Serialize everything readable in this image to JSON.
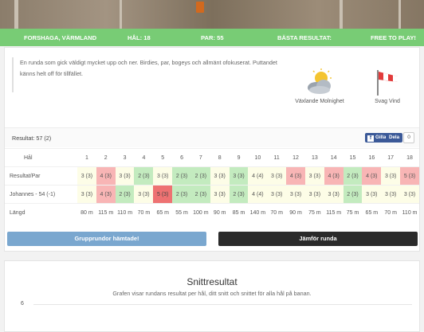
{
  "infobar": {
    "location": "FORSHAGA, VÄRMLAND",
    "hole": "HÅL: 18",
    "par": "PAR: 55",
    "best": "BÄSTA RESULTAT:",
    "fee": "FREE TO PLAY!"
  },
  "description": "En runda som gick väldigt mycket upp och ner. Birdies, par, bogeys och allmänt ofokuserat. Puttandet känns helt off för tillfället.",
  "weather": {
    "sky_label": "Växlande Molnighet",
    "sky_icon": "partly-cloudy-icon",
    "wind_label": "Svag Vind",
    "wind_icon": "windsock-icon"
  },
  "result": {
    "label": "Resultat: 57 (2)",
    "like_label": "Gilla",
    "share_label": "Dela",
    "share_count": "0"
  },
  "scorecard": {
    "hole_label": "Hål",
    "holes": [
      "1",
      "2",
      "3",
      "4",
      "5",
      "6",
      "7",
      "8",
      "9",
      "10",
      "11",
      "12",
      "13",
      "14",
      "15",
      "16",
      "17",
      "18"
    ],
    "rows": [
      {
        "label": "Resultat/Par",
        "cells": [
          {
            "text": "3 (3)",
            "status": "par"
          },
          {
            "text": "4 (3)",
            "status": "bogey"
          },
          {
            "text": "3 (3)",
            "status": "par"
          },
          {
            "text": "2 (3)",
            "status": "birdie"
          },
          {
            "text": "3 (3)",
            "status": "par"
          },
          {
            "text": "2 (3)",
            "status": "birdie"
          },
          {
            "text": "2 (3)",
            "status": "birdie"
          },
          {
            "text": "3 (3)",
            "status": "par"
          },
          {
            "text": "3 (3)",
            "status": "birdie"
          },
          {
            "text": "4 (4)",
            "status": "par"
          },
          {
            "text": "3 (3)",
            "status": "par"
          },
          {
            "text": "4 (3)",
            "status": "bogey"
          },
          {
            "text": "3 (3)",
            "status": "par"
          },
          {
            "text": "4 (3)",
            "status": "bogey"
          },
          {
            "text": "2 (3)",
            "status": "birdie"
          },
          {
            "text": "4 (3)",
            "status": "bogey"
          },
          {
            "text": "3 (3)",
            "status": "par"
          },
          {
            "text": "5 (3)",
            "status": "bogey"
          }
        ]
      },
      {
        "label": "Johannes - 54 (-1)",
        "cells": [
          {
            "text": "3 (3)",
            "status": "par"
          },
          {
            "text": "4 (3)",
            "status": "bogey"
          },
          {
            "text": "2 (3)",
            "status": "birdie"
          },
          {
            "text": "3 (3)",
            "status": "par"
          },
          {
            "text": "5 (3)",
            "status": "double"
          },
          {
            "text": "2 (3)",
            "status": "birdie"
          },
          {
            "text": "2 (3)",
            "status": "birdie"
          },
          {
            "text": "3 (3)",
            "status": "par"
          },
          {
            "text": "2 (3)",
            "status": "birdie"
          },
          {
            "text": "4 (4)",
            "status": "par"
          },
          {
            "text": "3 (3)",
            "status": "par"
          },
          {
            "text": "3 (3)",
            "status": "par"
          },
          {
            "text": "3 (3)",
            "status": "par"
          },
          {
            "text": "3 (3)",
            "status": "par"
          },
          {
            "text": "2 (3)",
            "status": "birdie"
          },
          {
            "text": "3 (3)",
            "status": "par"
          },
          {
            "text": "3 (3)",
            "status": "par"
          },
          {
            "text": "3 (3)",
            "status": "par"
          }
        ]
      },
      {
        "label": "Längd",
        "cells": [
          {
            "text": "80 m",
            "status": "none"
          },
          {
            "text": "115 m",
            "status": "none"
          },
          {
            "text": "110 m",
            "status": "none"
          },
          {
            "text": "70 m",
            "status": "none"
          },
          {
            "text": "65 m",
            "status": "none"
          },
          {
            "text": "55 m",
            "status": "none"
          },
          {
            "text": "100 m",
            "status": "none"
          },
          {
            "text": "90 m",
            "status": "none"
          },
          {
            "text": "85 m",
            "status": "none"
          },
          {
            "text": "140 m",
            "status": "none"
          },
          {
            "text": "70 m",
            "status": "none"
          },
          {
            "text": "90 m",
            "status": "none"
          },
          {
            "text": "75 m",
            "status": "none"
          },
          {
            "text": "115 m",
            "status": "none"
          },
          {
            "text": "75 m",
            "status": "none"
          },
          {
            "text": "65 m",
            "status": "none"
          },
          {
            "text": "70 m",
            "status": "none"
          },
          {
            "text": "110 m",
            "status": "none"
          }
        ]
      }
    ]
  },
  "buttons": {
    "group_label": "Grupprundor hämtade!",
    "compare_label": "Jämför runda"
  },
  "average": {
    "title": "Snittresultat",
    "subtitle": "Grafen visar rundans resultat per hål, ditt snitt och snittet för alla hål på banan.",
    "y_tick": "6"
  },
  "colors": {
    "infobar": "#78cc75",
    "par": "#fdfde7",
    "bogey": "#f8b5b5",
    "birdie": "#c3ebbf",
    "double": "#ee7272",
    "group_button": "#7aa7cf",
    "compare_button": "#2b2b2b"
  }
}
